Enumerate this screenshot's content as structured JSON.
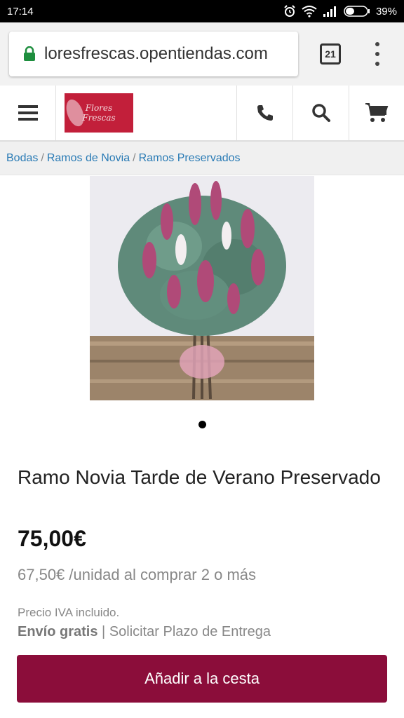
{
  "status_bar": {
    "time": "17:14",
    "battery": "39%"
  },
  "browser": {
    "url": "loresfrescas.opentiendas.com",
    "tab_count": "21"
  },
  "header": {
    "logo_line1": "Flores",
    "logo_line2": "Frescas"
  },
  "breadcrumb": {
    "items": [
      "Bodas",
      "Ramos de Novia",
      "Ramos Preservados"
    ],
    "separator": "/"
  },
  "product": {
    "title": "Ramo Novia Tarde de Verano Preservado",
    "price": "75,00€",
    "bulk_price": "67,50€",
    "bulk_text": "/unidad al comprar 2 o más",
    "tax_note": "Precio IVA incluido.",
    "shipping_free": "Envío gratis",
    "shipping_sep": "|",
    "delivery_link": "Solicitar Plazo de Entrega",
    "add_to_cart": "Añadir a la cesta"
  },
  "colors": {
    "accent": "#8b0d3a",
    "link": "#2a7bb5",
    "logo_bg": "#c21f3a"
  },
  "icons": [
    "menu-icon",
    "phone-icon",
    "search-icon",
    "cart-icon",
    "lock-icon",
    "alarm-icon",
    "wifi-icon",
    "signal-icon",
    "battery-icon"
  ]
}
